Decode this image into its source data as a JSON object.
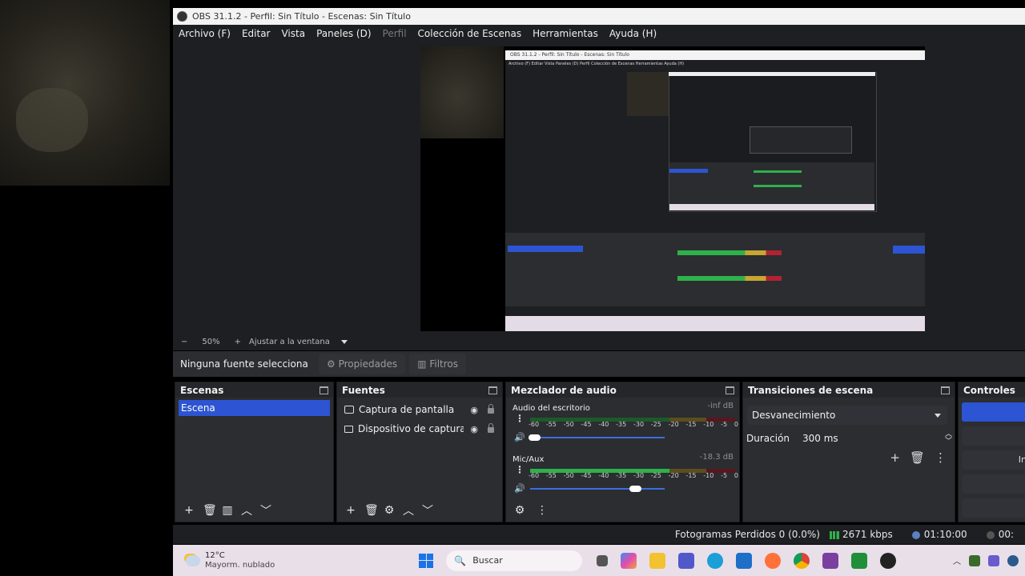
{
  "window": {
    "title": "OBS 31.1.2 - Perfil: Sin Título - Escenas: Sin Título"
  },
  "menu": [
    {
      "label": "Archivo (F)",
      "disabled": false
    },
    {
      "label": "Editar",
      "disabled": false
    },
    {
      "label": "Vista",
      "disabled": false
    },
    {
      "label": "Paneles (D)",
      "disabled": false
    },
    {
      "label": "Perfil",
      "disabled": true
    },
    {
      "label": "Colección de Escenas",
      "disabled": false
    },
    {
      "label": "Herramientas",
      "disabled": false
    },
    {
      "label": "Ayuda (H)",
      "disabled": false
    }
  ],
  "nested_preview": {
    "title": "OBS 31.1.2 - Perfil: Sin Título - Escenas: Sin Título",
    "menu": "Archivo (F)  Editar  Vista  Paneles (D)  Perfil  Colección de Escenas  Herramientas  Ayuda (H)"
  },
  "zoom": {
    "minus": "−",
    "level": "50%",
    "plus": "+",
    "fit": "Ajustar a la ventana"
  },
  "source_toolbar": {
    "label": "Ninguna fuente selecciona",
    "properties": "Propiedades",
    "filters": "Filtros"
  },
  "scenes": {
    "title": "Escenas",
    "items": [
      "Escena"
    ]
  },
  "sources": {
    "title": "Fuentes",
    "items": [
      {
        "name": "Captura de pantalla",
        "icon": "monitor-icon"
      },
      {
        "name": "Dispositivo de captura de v",
        "icon": "camera-icon"
      }
    ]
  },
  "mixer": {
    "title": "Mezclador de audio",
    "ticks": [
      "-60",
      "-55",
      "-50",
      "-45",
      "-40",
      "-35",
      "-30",
      "-25",
      "-20",
      "-15",
      "-10",
      "-5",
      "0"
    ],
    "channels": [
      {
        "name": "Audio del escritorio",
        "db": "-inf dB",
        "level": 0.0,
        "volume": 0.03
      },
      {
        "name": "Mic/Aux",
        "db": "-18.3 dB",
        "level": 0.68,
        "volume": 0.78
      }
    ]
  },
  "transitions": {
    "title": "Transiciones de escena",
    "selected": "Desvanecimiento",
    "duration_label": "Duración",
    "duration_value": "300 ms"
  },
  "controls": {
    "title": "Controles",
    "partial": "Ini"
  },
  "status": {
    "dropped": "Fotogramas Perdidos 0 (0.0%)",
    "bitrate": "2671 kbps",
    "rec_time": "01:10:00",
    "stream_time": "00:"
  },
  "taskbar": {
    "temp": "12°C",
    "weather": "Mayorm. nublado",
    "search": "Buscar"
  },
  "colors": {
    "accent": "#2d54d2",
    "meter_green": "#2fb14a",
    "meter_yellow": "#c8a632",
    "meter_red": "#b32233"
  }
}
